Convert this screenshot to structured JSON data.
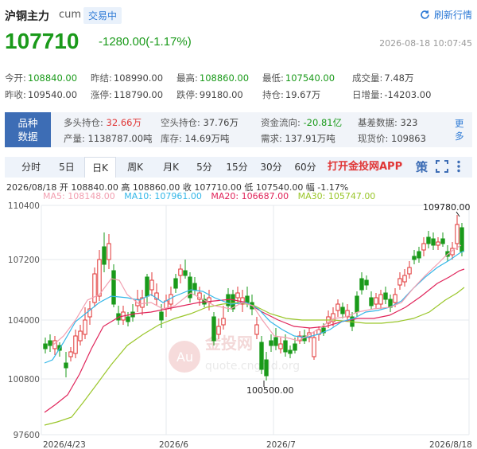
{
  "header": {
    "title": "沪铜主力",
    "code": "cum",
    "status": "交易中",
    "refresh_label": "刷新行情",
    "last_price": "107710",
    "change": "-1280.00(-1.17%)",
    "timestamp": "2026-08-18 10:07:45"
  },
  "stats": {
    "open_label": "今开:",
    "open": "108840.00",
    "prev_close_label": "昨结:",
    "prev_close": "108990.00",
    "high_label": "最高:",
    "high": "108860.00",
    "low_label": "最低:",
    "low": "107540.00",
    "volume_label": "成交量:",
    "volume": "7.48万",
    "prev_settle_label": "昨收:",
    "prev_settle": "109540.00",
    "limit_up_label": "涨停:",
    "limit_up": "118790.00",
    "limit_down_label": "跌停:",
    "limit_down": "99180.00",
    "oi_label": "持仓:",
    "oi": "19.67万",
    "daily_inc_label": "日增量:",
    "daily_inc": "-14203.00"
  },
  "info": {
    "label_line1": "品种",
    "label_line2": "数据",
    "long_label": "多头持仓:",
    "long": "32.66万",
    "short_label": "空头持仓:",
    "short": "37.76万",
    "flow_label": "资金流向:",
    "flow": "-20.81亿",
    "basis_label": "基差数据:",
    "basis": "323",
    "output_label": "产量:",
    "output": "1138787.00吨",
    "stock_label": "库存:",
    "stock": "14.69万吨",
    "demand_label": "需求:",
    "demand": "137.91万吨",
    "spot_label": "现货价:",
    "spot": "109863",
    "more_line1": "更",
    "more_line2": "多"
  },
  "tabs": [
    "分时",
    "5日",
    "日K",
    "周K",
    "月K",
    "5分",
    "15分",
    "30分",
    "60分"
  ],
  "active_tab": "日K",
  "app_link": "打开金投网APP",
  "kline_info": "2026/08/18  开 108840.00  高 108860.00  收 107710.00  低 107540.00  幅 -1.17%",
  "ma_legend": {
    "ma5": "MA5: 108148.00",
    "ma10": "MA10: 107961.00",
    "ma20": "MA20: 106687.00",
    "ma30": "MA30: 105747.00"
  },
  "watermark": {
    "brand": "金投网",
    "url": "quote.cngold.org"
  },
  "colors": {
    "up": "#e03535",
    "down": "#1a9a1a",
    "ma5": "#f29fb0",
    "ma10": "#34b7e8",
    "ma20": "#e0245a",
    "ma30": "#9ac62a",
    "accent": "#2f7bd6"
  },
  "chart_data": {
    "type": "candlestick",
    "y_ticks": [
      "110400",
      "107200",
      "104000",
      "100800",
      "97600"
    ],
    "x_ticks": [
      "2026/4/23",
      "2026/6",
      "2026/7",
      "2026/8/18"
    ],
    "ylim": [
      97600,
      110400
    ],
    "annotations": {
      "max": "109780.00",
      "min": "100500.00"
    }
  }
}
